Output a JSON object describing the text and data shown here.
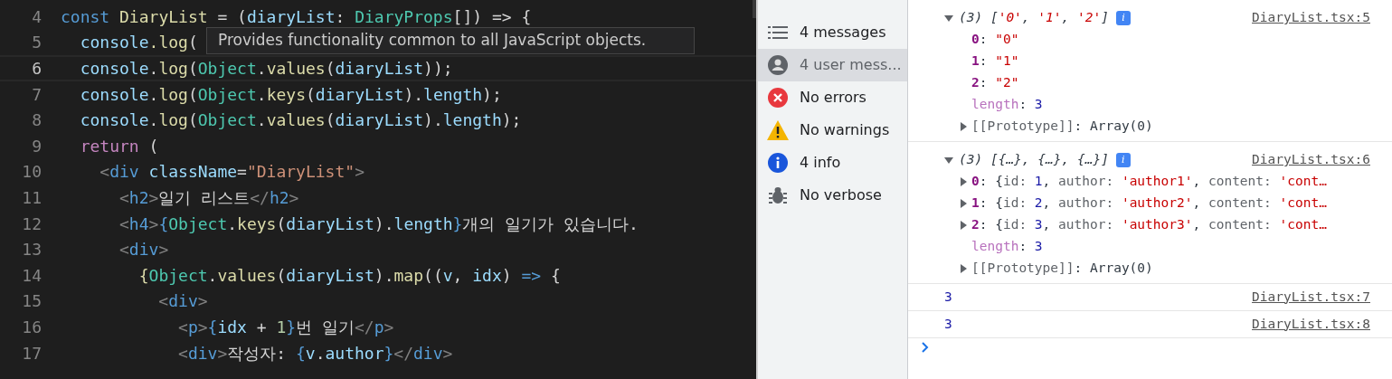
{
  "editor": {
    "lines": [
      {
        "number": "4",
        "current": false,
        "tokens": [
          {
            "text": "const ",
            "kind": "keyword"
          },
          {
            "text": "DiaryList",
            "kind": "function"
          },
          {
            "text": " = (",
            "kind": "plain"
          },
          {
            "text": "diaryList",
            "kind": "variable"
          },
          {
            "text": ": ",
            "kind": "plain"
          },
          {
            "text": "DiaryProps",
            "kind": "type"
          },
          {
            "text": "[]) => {",
            "kind": "plain"
          }
        ]
      },
      {
        "number": "5",
        "current": false,
        "tokens": [
          {
            "text": "  console",
            "kind": "variable"
          },
          {
            "text": ".log",
            "kind": "function"
          },
          {
            "text": "(",
            "kind": "plain"
          }
        ]
      },
      {
        "number": "6",
        "current": true,
        "tokens": [
          {
            "text": "  console",
            "kind": "variable"
          },
          {
            "text": ".",
            "kind": "plain"
          },
          {
            "text": "log",
            "kind": "function"
          },
          {
            "text": "(",
            "kind": "plain"
          },
          {
            "text": "Object",
            "kind": "type"
          },
          {
            "text": ".",
            "kind": "plain"
          },
          {
            "text": "values",
            "kind": "function"
          },
          {
            "text": "(",
            "kind": "plain"
          },
          {
            "text": "diaryList",
            "kind": "variable"
          },
          {
            "text": "));",
            "kind": "plain"
          }
        ]
      },
      {
        "number": "7",
        "current": false,
        "tokens": [
          {
            "text": "  console",
            "kind": "variable"
          },
          {
            "text": ".",
            "kind": "plain"
          },
          {
            "text": "log",
            "kind": "function"
          },
          {
            "text": "(",
            "kind": "plain"
          },
          {
            "text": "Object",
            "kind": "type"
          },
          {
            "text": ".",
            "kind": "plain"
          },
          {
            "text": "keys",
            "kind": "function"
          },
          {
            "text": "(",
            "kind": "plain"
          },
          {
            "text": "diaryList",
            "kind": "variable"
          },
          {
            "text": ").",
            "kind": "plain"
          },
          {
            "text": "length",
            "kind": "variable"
          },
          {
            "text": ");",
            "kind": "plain"
          }
        ]
      },
      {
        "number": "8",
        "current": false,
        "tokens": [
          {
            "text": "  console",
            "kind": "variable"
          },
          {
            "text": ".",
            "kind": "plain"
          },
          {
            "text": "log",
            "kind": "function"
          },
          {
            "text": "(",
            "kind": "plain"
          },
          {
            "text": "Object",
            "kind": "type"
          },
          {
            "text": ".",
            "kind": "plain"
          },
          {
            "text": "values",
            "kind": "function"
          },
          {
            "text": "(",
            "kind": "plain"
          },
          {
            "text": "diaryList",
            "kind": "variable"
          },
          {
            "text": ").",
            "kind": "plain"
          },
          {
            "text": "length",
            "kind": "variable"
          },
          {
            "text": ");",
            "kind": "plain"
          }
        ]
      },
      {
        "number": "9",
        "current": false,
        "tokens": [
          {
            "text": "  return",
            "kind": "control"
          },
          {
            "text": " (",
            "kind": "plain"
          }
        ]
      },
      {
        "number": "10",
        "current": false,
        "tokens": [
          {
            "text": "    <",
            "kind": "bracket"
          },
          {
            "text": "div",
            "kind": "keyword"
          },
          {
            "text": " className",
            "kind": "variable"
          },
          {
            "text": "=",
            "kind": "plain"
          },
          {
            "text": "\"DiaryList\"",
            "kind": "string"
          },
          {
            "text": ">",
            "kind": "bracket"
          }
        ]
      },
      {
        "number": "11",
        "current": false,
        "tokens": [
          {
            "text": "      <",
            "kind": "bracket"
          },
          {
            "text": "h2",
            "kind": "keyword"
          },
          {
            "text": ">",
            "kind": "bracket"
          },
          {
            "text": "일기 리스트",
            "kind": "plain"
          },
          {
            "text": "</",
            "kind": "bracket"
          },
          {
            "text": "h2",
            "kind": "keyword"
          },
          {
            "text": ">",
            "kind": "bracket"
          }
        ]
      },
      {
        "number": "12",
        "current": false,
        "tokens": [
          {
            "text": "      <",
            "kind": "bracket"
          },
          {
            "text": "h4",
            "kind": "keyword"
          },
          {
            "text": ">",
            "kind": "bracket"
          },
          {
            "text": "{",
            "kind": "keyword"
          },
          {
            "text": "Object",
            "kind": "type"
          },
          {
            "text": ".",
            "kind": "plain"
          },
          {
            "text": "keys",
            "kind": "function"
          },
          {
            "text": "(",
            "kind": "plain"
          },
          {
            "text": "diaryList",
            "kind": "variable"
          },
          {
            "text": ").",
            "kind": "plain"
          },
          {
            "text": "length",
            "kind": "variable"
          },
          {
            "text": "}",
            "kind": "keyword"
          },
          {
            "text": "개의 일기가 있습니다.",
            "kind": "plain"
          }
        ]
      },
      {
        "number": "13",
        "current": false,
        "tokens": [
          {
            "text": "      <",
            "kind": "bracket"
          },
          {
            "text": "div",
            "kind": "keyword"
          },
          {
            "text": ">",
            "kind": "bracket"
          }
        ]
      },
      {
        "number": "14",
        "current": false,
        "tokens": [
          {
            "text": "        {",
            "kind": "function"
          },
          {
            "text": "Object",
            "kind": "type"
          },
          {
            "text": ".",
            "kind": "plain"
          },
          {
            "text": "values",
            "kind": "function"
          },
          {
            "text": "(",
            "kind": "plain"
          },
          {
            "text": "diaryList",
            "kind": "variable"
          },
          {
            "text": ").",
            "kind": "plain"
          },
          {
            "text": "map",
            "kind": "function"
          },
          {
            "text": "((",
            "kind": "plain"
          },
          {
            "text": "v",
            "kind": "variable"
          },
          {
            "text": ", ",
            "kind": "plain"
          },
          {
            "text": "idx",
            "kind": "variable"
          },
          {
            "text": ") ",
            "kind": "plain"
          },
          {
            "text": "=>",
            "kind": "keyword"
          },
          {
            "text": " {",
            "kind": "plain"
          }
        ]
      },
      {
        "number": "15",
        "current": false,
        "tokens": [
          {
            "text": "          <",
            "kind": "bracket"
          },
          {
            "text": "div",
            "kind": "keyword"
          },
          {
            "text": ">",
            "kind": "bracket"
          }
        ]
      },
      {
        "number": "16",
        "current": false,
        "tokens": [
          {
            "text": "            <",
            "kind": "bracket"
          },
          {
            "text": "p",
            "kind": "keyword"
          },
          {
            "text": ">",
            "kind": "bracket"
          },
          {
            "text": "{",
            "kind": "keyword"
          },
          {
            "text": "idx",
            "kind": "variable"
          },
          {
            "text": " + ",
            "kind": "plain"
          },
          {
            "text": "1",
            "kind": "number"
          },
          {
            "text": "}",
            "kind": "keyword"
          },
          {
            "text": "번 일기",
            "kind": "plain"
          },
          {
            "text": "</",
            "kind": "bracket"
          },
          {
            "text": "p",
            "kind": "keyword"
          },
          {
            "text": ">",
            "kind": "bracket"
          }
        ]
      },
      {
        "number": "17",
        "current": false,
        "tokens": [
          {
            "text": "            <",
            "kind": "bracket"
          },
          {
            "text": "div",
            "kind": "keyword"
          },
          {
            "text": ">",
            "kind": "bracket"
          },
          {
            "text": "작성자: ",
            "kind": "plain"
          },
          {
            "text": "{",
            "kind": "keyword"
          },
          {
            "text": "v",
            "kind": "variable"
          },
          {
            "text": ".",
            "kind": "plain"
          },
          {
            "text": "author",
            "kind": "variable"
          },
          {
            "text": "}",
            "kind": "keyword"
          },
          {
            "text": "</",
            "kind": "bracket"
          },
          {
            "text": "div",
            "kind": "keyword"
          },
          {
            "text": ">",
            "kind": "bracket"
          }
        ]
      }
    ],
    "tooltip": {
      "text": "Provides functionality common to all JavaScript objects."
    }
  },
  "console": {
    "sidebar": [
      {
        "kind": "list",
        "label": "4 messages",
        "selected": false
      },
      {
        "kind": "user",
        "label": "4 user mess...",
        "selected": true
      },
      {
        "kind": "error",
        "label": "No errors",
        "selected": false
      },
      {
        "kind": "warning",
        "label": "No warnings",
        "selected": false
      },
      {
        "kind": "info",
        "label": "4 info",
        "selected": false
      },
      {
        "kind": "bug",
        "label": "No verbose",
        "selected": false
      }
    ],
    "entries": [
      {
        "kind": "object",
        "expanded": true,
        "badge": "i",
        "source": "DiaryList.tsx:5",
        "summary": [
          {
            "text": "(3) [",
            "kind": "italic"
          },
          {
            "text": "'0'",
            "kind": "string-italic"
          },
          {
            "text": ", ",
            "kind": "italic"
          },
          {
            "text": "'1'",
            "kind": "string-italic"
          },
          {
            "text": ", ",
            "kind": "italic"
          },
          {
            "text": "'2'",
            "kind": "string-italic"
          },
          {
            "text": "]",
            "kind": "italic"
          }
        ],
        "children": [
          {
            "expandable": false,
            "tokens": [
              {
                "text": "0",
                "kind": "key"
              },
              {
                "text": ": ",
                "kind": "plain"
              },
              {
                "text": "\"0\"",
                "kind": "string"
              }
            ]
          },
          {
            "expandable": false,
            "tokens": [
              {
                "text": "1",
                "kind": "key"
              },
              {
                "text": ": ",
                "kind": "plain"
              },
              {
                "text": "\"1\"",
                "kind": "string"
              }
            ]
          },
          {
            "expandable": false,
            "tokens": [
              {
                "text": "2",
                "kind": "key"
              },
              {
                "text": ": ",
                "kind": "plain"
              },
              {
                "text": "\"2\"",
                "kind": "string"
              }
            ]
          },
          {
            "expandable": false,
            "tokens": [
              {
                "text": "length",
                "kind": "meta"
              },
              {
                "text": ": ",
                "kind": "plain"
              },
              {
                "text": "3",
                "kind": "number"
              }
            ]
          },
          {
            "expandable": true,
            "tokens": [
              {
                "text": "[[Prototype]]",
                "kind": "muted"
              },
              {
                "text": ": Array(0)",
                "kind": "plain"
              }
            ]
          }
        ]
      },
      {
        "kind": "object",
        "expanded": true,
        "badge": "i",
        "source": "DiaryList.tsx:6",
        "summary": [
          {
            "text": "(3) [{…}, {…}, {…}]",
            "kind": "italic"
          }
        ],
        "children": [
          {
            "expandable": true,
            "tokens": [
              {
                "text": "0",
                "kind": "key"
              },
              {
                "text": ": {",
                "kind": "plain"
              },
              {
                "text": "id: ",
                "kind": "muted"
              },
              {
                "text": "1",
                "kind": "number"
              },
              {
                "text": ", ",
                "kind": "plain"
              },
              {
                "text": "author: ",
                "kind": "muted"
              },
              {
                "text": "'author1'",
                "kind": "string"
              },
              {
                "text": ", ",
                "kind": "plain"
              },
              {
                "text": "content: ",
                "kind": "muted"
              },
              {
                "text": "'cont…",
                "kind": "string"
              }
            ]
          },
          {
            "expandable": true,
            "tokens": [
              {
                "text": "1",
                "kind": "key"
              },
              {
                "text": ": {",
                "kind": "plain"
              },
              {
                "text": "id: ",
                "kind": "muted"
              },
              {
                "text": "2",
                "kind": "number"
              },
              {
                "text": ", ",
                "kind": "plain"
              },
              {
                "text": "author: ",
                "kind": "muted"
              },
              {
                "text": "'author2'",
                "kind": "string"
              },
              {
                "text": ", ",
                "kind": "plain"
              },
              {
                "text": "content: ",
                "kind": "muted"
              },
              {
                "text": "'cont…",
                "kind": "string"
              }
            ]
          },
          {
            "expandable": true,
            "tokens": [
              {
                "text": "2",
                "kind": "key"
              },
              {
                "text": ": {",
                "kind": "plain"
              },
              {
                "text": "id: ",
                "kind": "muted"
              },
              {
                "text": "3",
                "kind": "number"
              },
              {
                "text": ", ",
                "kind": "plain"
              },
              {
                "text": "author: ",
                "kind": "muted"
              },
              {
                "text": "'author3'",
                "kind": "string"
              },
              {
                "text": ", ",
                "kind": "plain"
              },
              {
                "text": "content: ",
                "kind": "muted"
              },
              {
                "text": "'cont…",
                "kind": "string"
              }
            ]
          },
          {
            "expandable": false,
            "tokens": [
              {
                "text": "length",
                "kind": "meta"
              },
              {
                "text": ": ",
                "kind": "plain"
              },
              {
                "text": "3",
                "kind": "number"
              }
            ]
          },
          {
            "expandable": true,
            "tokens": [
              {
                "text": "[[Prototype]]",
                "kind": "muted"
              },
              {
                "text": ": Array(0)",
                "kind": "plain"
              }
            ]
          }
        ]
      },
      {
        "kind": "value",
        "text": "3",
        "source": "DiaryList.tsx:7"
      },
      {
        "kind": "value",
        "text": "3",
        "source": "DiaryList.tsx:8"
      }
    ]
  }
}
